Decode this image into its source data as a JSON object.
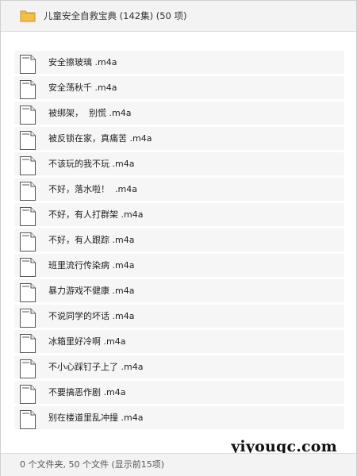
{
  "header": {
    "title": "儿童安全自救宝典 (142集) (50 项)",
    "icon": "folder-icon"
  },
  "files": [
    {
      "name": "安全擦玻璃 .m4a"
    },
    {
      "name": "安全荡秋千 .m4a"
    },
    {
      "name": "被绑架，  别慌 .m4a"
    },
    {
      "name": "被反锁在家，真痛苦 .m4a"
    },
    {
      "name": "不该玩的我不玩 .m4a"
    },
    {
      "name": "不好，落水啦！  .m4a"
    },
    {
      "name": "不好，有人打群架 .m4a"
    },
    {
      "name": "不好，有人跟踪 .m4a"
    },
    {
      "name": "班里流行传染病 .m4a"
    },
    {
      "name": "暴力游戏不健康 .m4a"
    },
    {
      "name": "不说同学的坏话 .m4a"
    },
    {
      "name": "冰箱里好冷啊 .m4a"
    },
    {
      "name": "不小心踩钉子上了 .m4a"
    },
    {
      "name": "不要搞恶作剧 .m4a"
    },
    {
      "name": "别在楼道里乱冲撞 .m4a"
    }
  ],
  "status": {
    "text": "0 个文件夹, 50 个文件 (显示前15项)"
  },
  "watermark": "yiyouqc.com",
  "colors": {
    "folder": "#f2c04a",
    "row_bg": "#f6f6f6",
    "bar_bg": "#f3f3f3"
  }
}
